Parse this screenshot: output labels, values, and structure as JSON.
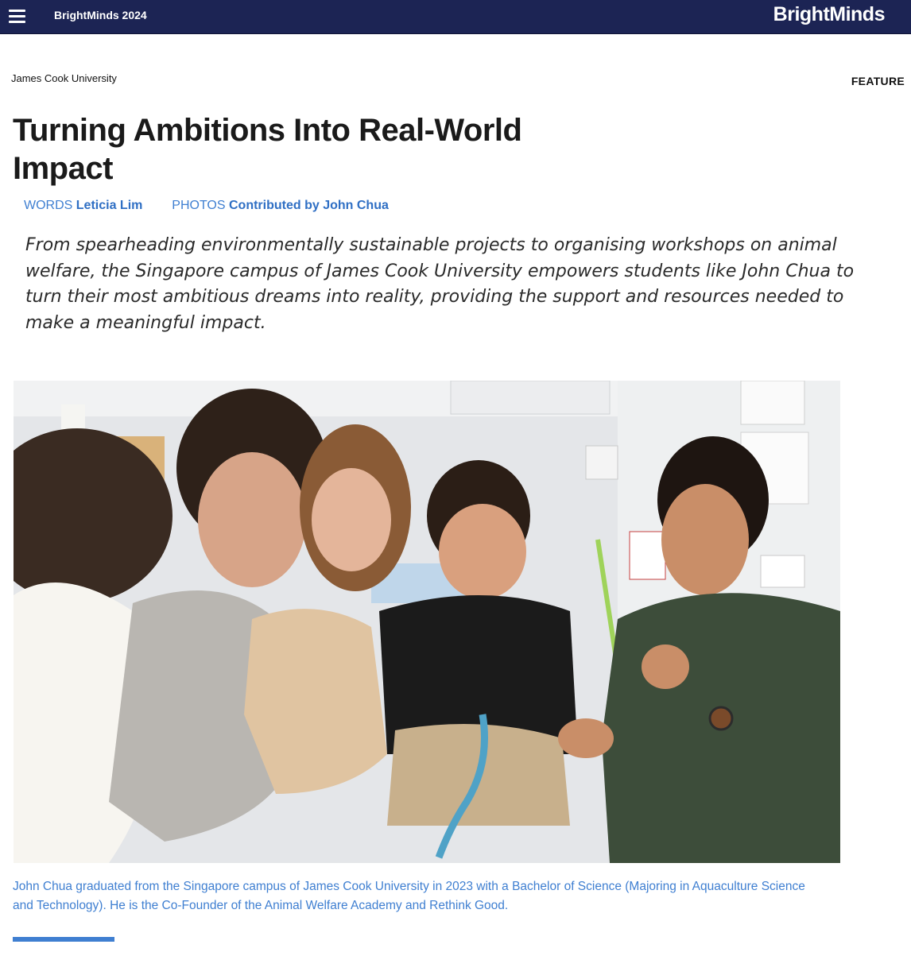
{
  "header": {
    "menu_icon": "hamburger-menu-icon",
    "edition": "BrightMinds 2024",
    "brand": "BrightMinds",
    "background_color": "#1c2454"
  },
  "article": {
    "university": "James Cook University",
    "category": "FEATURE",
    "title": "Turning Ambitions Into Real-World Impact",
    "credits": {
      "words_label": "WORDS",
      "words_author": "Leticia Lim",
      "photos_label": "PHOTOS",
      "photos_credit": "Contributed by John Chua"
    },
    "lede": "From spearheading environmentally sustainable projects to organising workshops on animal welfare, the Singapore campus of James Cook University empowers students like John Chua to turn their most ambitious dreams into reality, providing the support and resources needed to make a meaningful impact.",
    "photo": {
      "caption": "John Chua graduated from the Singapore campus of James Cook University in 2023 with a Bachelor of Science (Majoring in Aquaculture Science and Technology). He is the Co-Founder of the Animal Welfare Academy and Rethink Good."
    },
    "accent_color": "#3f7fd1"
  }
}
